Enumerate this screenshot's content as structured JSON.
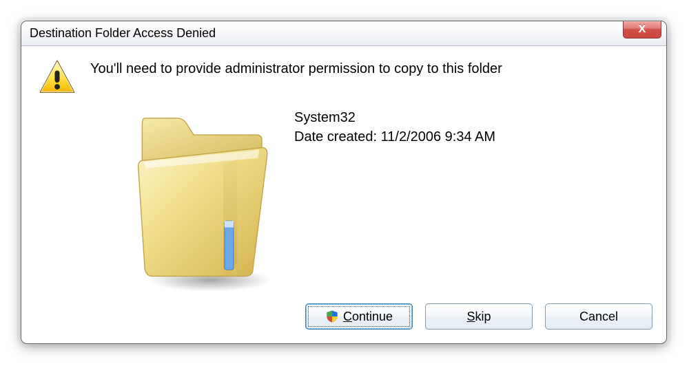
{
  "dialog": {
    "title": "Destination Folder Access Denied",
    "message": "You'll need to provide administrator permission to copy to this folder",
    "folder": {
      "name": "System32",
      "date_label": "Date created: 11/2/2006 9:34 AM"
    },
    "buttons": {
      "continue": {
        "prefix": "",
        "mnemonic": "C",
        "suffix": "ontinue"
      },
      "skip": {
        "prefix": "",
        "mnemonic": "S",
        "suffix": "kip"
      },
      "cancel": {
        "label": "Cancel"
      }
    },
    "close_glyph": "X"
  },
  "icons": {
    "warning": "warning-icon",
    "folder": "folder-icon",
    "shield": "shield-icon"
  }
}
